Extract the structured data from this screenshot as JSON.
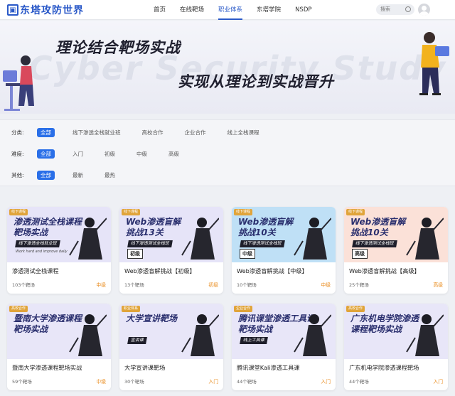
{
  "header": {
    "logo_text": "东塔攻防世界",
    "nav": [
      {
        "label": "首页",
        "active": false
      },
      {
        "label": "在线靶场",
        "active": false
      },
      {
        "label": "职业体系",
        "active": true
      },
      {
        "label": "东塔学院",
        "active": false
      },
      {
        "label": "NSDP",
        "active": false
      }
    ],
    "search_placeholder": "搜索"
  },
  "banner": {
    "line1": "理论结合靶场实战",
    "line2": "实现从理论到实战晋升",
    "background_text": "Cyber Security Study"
  },
  "filters": [
    {
      "label": "分类:",
      "options": [
        "全部",
        "线下渗透全栈就业班",
        "高校合作",
        "企业合作",
        "线上全栈课程"
      ],
      "selected": 0
    },
    {
      "label": "难度:",
      "options": [
        "全部",
        "入门",
        "初级",
        "中级",
        "高级"
      ],
      "selected": 0
    },
    {
      "label": "其他:",
      "options": [
        "全部",
        "最新",
        "最热"
      ],
      "selected": 0
    }
  ],
  "courses": [
    {
      "tag": "线下课程",
      "tag_color": "#e0a43a",
      "thumb_title": [
        "渗透测试全栈课程",
        "靶场实战"
      ],
      "thumb_sub": "线下渗透全栈就业班",
      "thumb_extra": "Work hard and improve daily",
      "level_box": "",
      "bg": "#e6e4f8",
      "title": "渗透测试全栈课程",
      "count": "103个靶场",
      "level": "中级",
      "level_color": "#e98a1a"
    },
    {
      "tag": "线下课程",
      "tag_color": "#e0a43a",
      "thumb_title": [
        "Web渗透盲解",
        "挑战13关"
      ],
      "thumb_sub": "线下渗透测试全栈班",
      "thumb_extra": "",
      "level_box": "初级",
      "bg": "#e6e4f8",
      "title": "Web渗透盲解挑战【初级】",
      "count": "13个靶场",
      "level": "初级",
      "level_color": "#e98a1a"
    },
    {
      "tag": "线下课程",
      "tag_color": "#e0a43a",
      "thumb_title": [
        "Web渗透盲解",
        "挑战10关"
      ],
      "thumb_sub": "线下渗透测试全栈班",
      "thumb_extra": "",
      "level_box": "中级",
      "bg": "#bfe0f6",
      "title": "Web渗透盲解挑战【中级】",
      "count": "10个靶场",
      "level": "中级",
      "level_color": "#e98a1a"
    },
    {
      "tag": "线下课程",
      "tag_color": "#e0a43a",
      "thumb_title": [
        "Web渗透盲解",
        "挑战10关"
      ],
      "thumb_sub": "线下渗透测试全栈班",
      "thumb_extra": "",
      "level_box": "高级",
      "bg": "#fbe1d8",
      "title": "Web渗透盲解挑战【高级】",
      "count": "25个靶场",
      "level": "高级",
      "level_color": "#e98a1a"
    },
    {
      "tag": "高校合作",
      "tag_color": "#e0a43a",
      "thumb_title": [
        "暨南大学渗透课程",
        "靶场实战"
      ],
      "thumb_sub": "",
      "thumb_extra": "",
      "level_box": "",
      "bg": "#e8e6f8",
      "title": "暨南大学渗透课程靶场实战",
      "count": "59个靶场",
      "level": "中级",
      "level_color": "#e98a1a"
    },
    {
      "tag": "职业体系",
      "tag_color": "#e0a43a",
      "thumb_title": [
        "大学宣讲靶场"
      ],
      "thumb_sub": "宣讲课",
      "thumb_extra": "",
      "level_box": "",
      "bg": "#e8e6f8",
      "title": "大学宣讲课靶场",
      "count": "30个靶场",
      "level": "入门",
      "level_color": "#e98a1a"
    },
    {
      "tag": "企业合作",
      "tag_color": "#e0a43a",
      "thumb_title": [
        "腾讯课堂渗透工具课",
        "靶场实战"
      ],
      "thumb_sub": "线上工具课",
      "thumb_extra": "",
      "level_box": "",
      "bg": "#e8e6f8",
      "title": "腾讯课堂Kali渗透工具课",
      "count": "44个靶场",
      "level": "入门",
      "level_color": "#e98a1a"
    },
    {
      "tag": "高校合作",
      "tag_color": "#e0a43a",
      "thumb_title": [
        "广东机电学院渗透",
        "课程靶场实战"
      ],
      "thumb_sub": "",
      "thumb_extra": "",
      "level_box": "",
      "bg": "#e8e6f8",
      "title": "广东机电学院渗透课程靶场",
      "count": "44个靶场",
      "level": "入门",
      "level_color": "#e98a1a"
    }
  ],
  "colors": {
    "accent": "#2a59c8",
    "chip_active": "#2a6fe8",
    "level": "#e98a1a"
  }
}
